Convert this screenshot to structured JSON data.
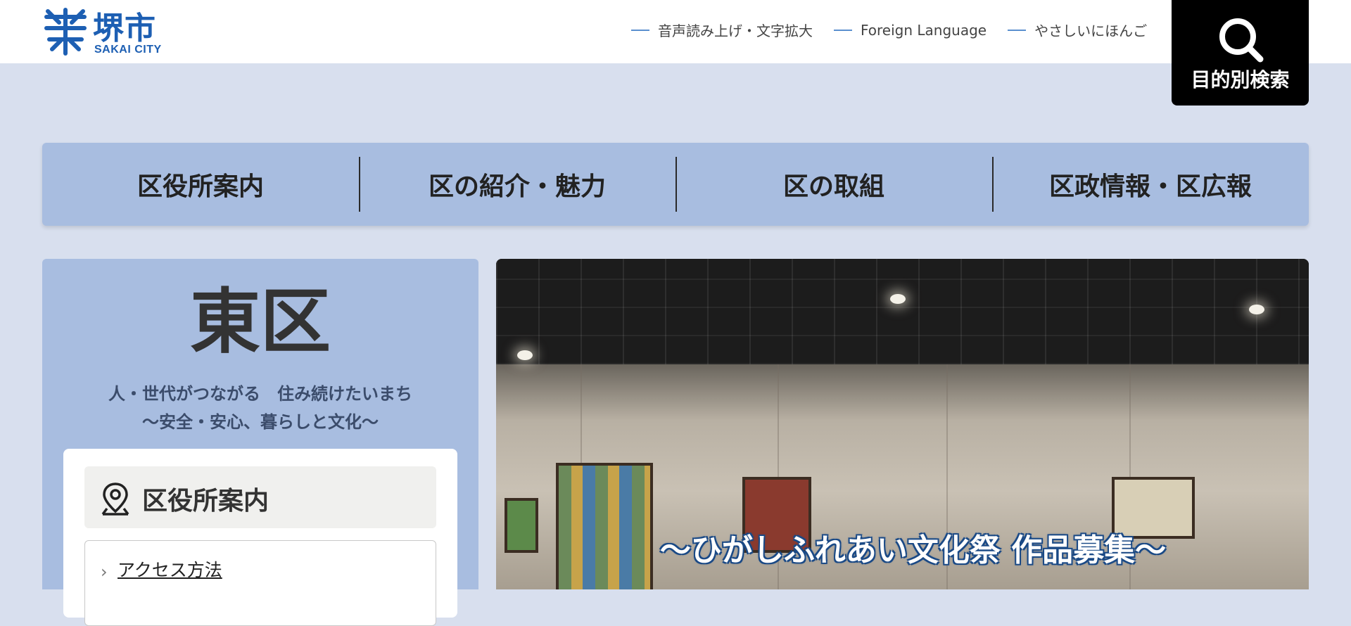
{
  "header": {
    "logo_kanji": "堺市",
    "logo_en": "SAKAI CITY",
    "util_links": [
      "音声読み上げ・文字拡大",
      "Foreign Language",
      "やさしいにほんご"
    ],
    "search_label": "目的別検索"
  },
  "nav": {
    "items": [
      "区役所案内",
      "区の紹介・魅力",
      "区の取組",
      "区政情報・区広報"
    ]
  },
  "side": {
    "ward_name": "東区",
    "tagline_1": "人・世代がつながる　住み続けたいまち",
    "tagline_2": "〜安全・安心、暮らしと文化〜",
    "card_title": "区役所案内",
    "link_1": "アクセス方法"
  },
  "hero": {
    "caption": "〜ひがしふれあい文化祭 作品募集〜"
  },
  "colors": {
    "page_bg": "#d8dfee",
    "nav_bg": "#a8bde0",
    "brand_blue": "#1d5fb3",
    "search_bg": "#000000"
  }
}
